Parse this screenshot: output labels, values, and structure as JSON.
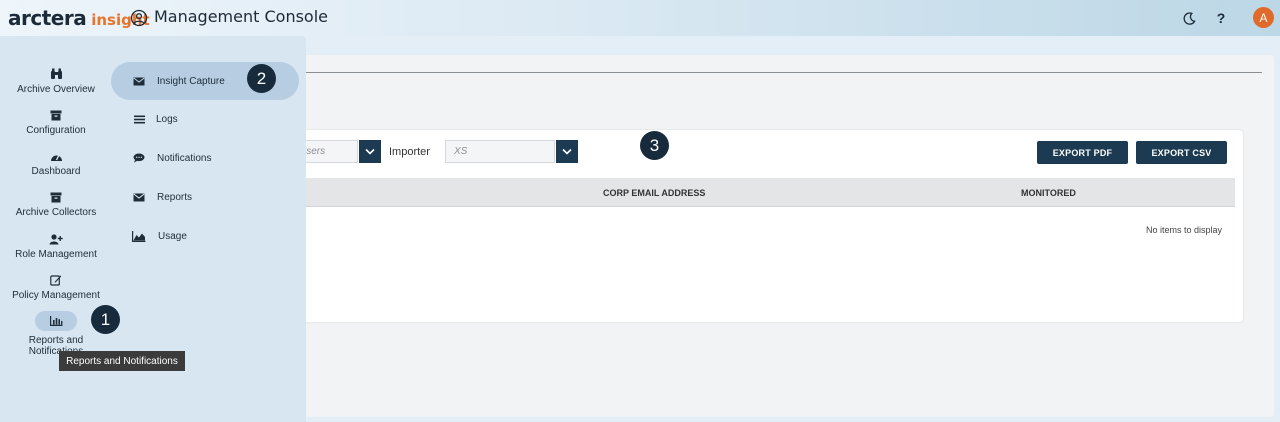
{
  "header": {
    "logo_main": "arctera",
    "logo_accent": "insight",
    "title": "Management Console",
    "help_label": "?",
    "avatar_initial": "A",
    "brand_accent_color": "#e8742a",
    "theme_icon": "moon-icon",
    "console_icon": "user-circle-icon"
  },
  "nav": {
    "items": [
      {
        "label": "Archive Overview",
        "icon": "binoculars-icon"
      },
      {
        "label": "Configuration",
        "icon": "archive-box-icon"
      },
      {
        "label": "Dashboard",
        "icon": "gauge-icon"
      },
      {
        "label": "Archive Collectors",
        "icon": "archive-box-icon"
      },
      {
        "label": "Role Management",
        "icon": "user-plus-icon"
      },
      {
        "label": "Policy Management",
        "icon": "edit-icon"
      },
      {
        "label": "Reports and Notifications",
        "icon": "bar-chart-icon"
      }
    ],
    "tooltip": "Reports and Notifications"
  },
  "submenu": {
    "items": [
      {
        "label": "Insight Capture",
        "icon": "envelope-icon"
      },
      {
        "label": "Logs",
        "icon": "list-icon"
      },
      {
        "label": "Notifications",
        "icon": "chat-bubble-icon"
      },
      {
        "label": "Reports",
        "icon": "envelope-icon"
      },
      {
        "label": "Usage",
        "icon": "area-chart-icon"
      }
    ]
  },
  "content": {
    "filter1_value": "Users",
    "importer_label": "Importer",
    "importer_value": "XS",
    "export_pdf_label": "EXPORT PDF",
    "export_csv_label": "EXPORT CSV",
    "columns": [
      "CORP EMAIL ADDRESS",
      "MONITORED"
    ],
    "empty_message": "No items to display"
  },
  "badges": [
    "1",
    "2",
    "3"
  ]
}
